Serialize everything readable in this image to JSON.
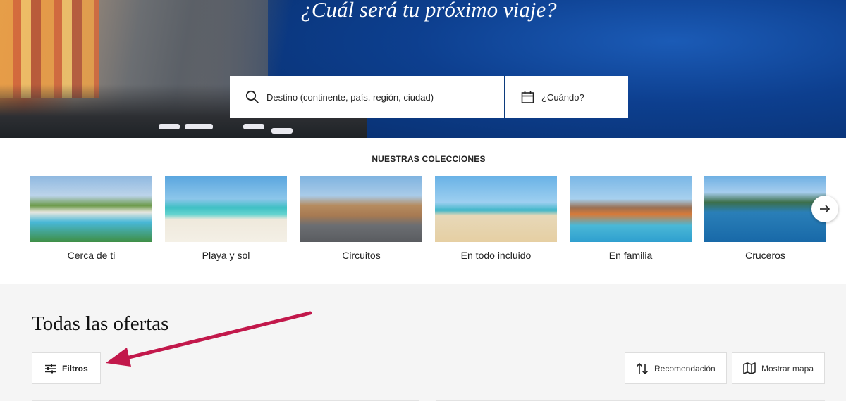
{
  "hero": {
    "title": "¿Cuál será tu próximo viaje?",
    "search": {
      "destination_placeholder": "Destino (continente, país, región, ciudad)",
      "date_placeholder": "¿Cuándo?",
      "search_icon": "search-icon",
      "date_icon": "calendar-icon"
    }
  },
  "collections": {
    "title": "NUESTRAS COLECCIONES",
    "items": [
      {
        "label": "Cerca de ti"
      },
      {
        "label": "Playa y sol"
      },
      {
        "label": "Circuitos"
      },
      {
        "label": "En todo incluido"
      },
      {
        "label": "En familia"
      },
      {
        "label": "Cruceros"
      }
    ],
    "next_icon": "arrow-right-icon"
  },
  "offers": {
    "title": "Todas las ofertas",
    "filters_label": "Filtros",
    "filters_icon": "sliders-icon",
    "sort_label": "Recomendación",
    "sort_icon": "sort-arrows-icon",
    "map_label": "Mostrar mapa",
    "map_icon": "map-icon"
  },
  "colors": {
    "annotation_arrow": "#c2184b",
    "search_divider": "#0c3b7d"
  }
}
